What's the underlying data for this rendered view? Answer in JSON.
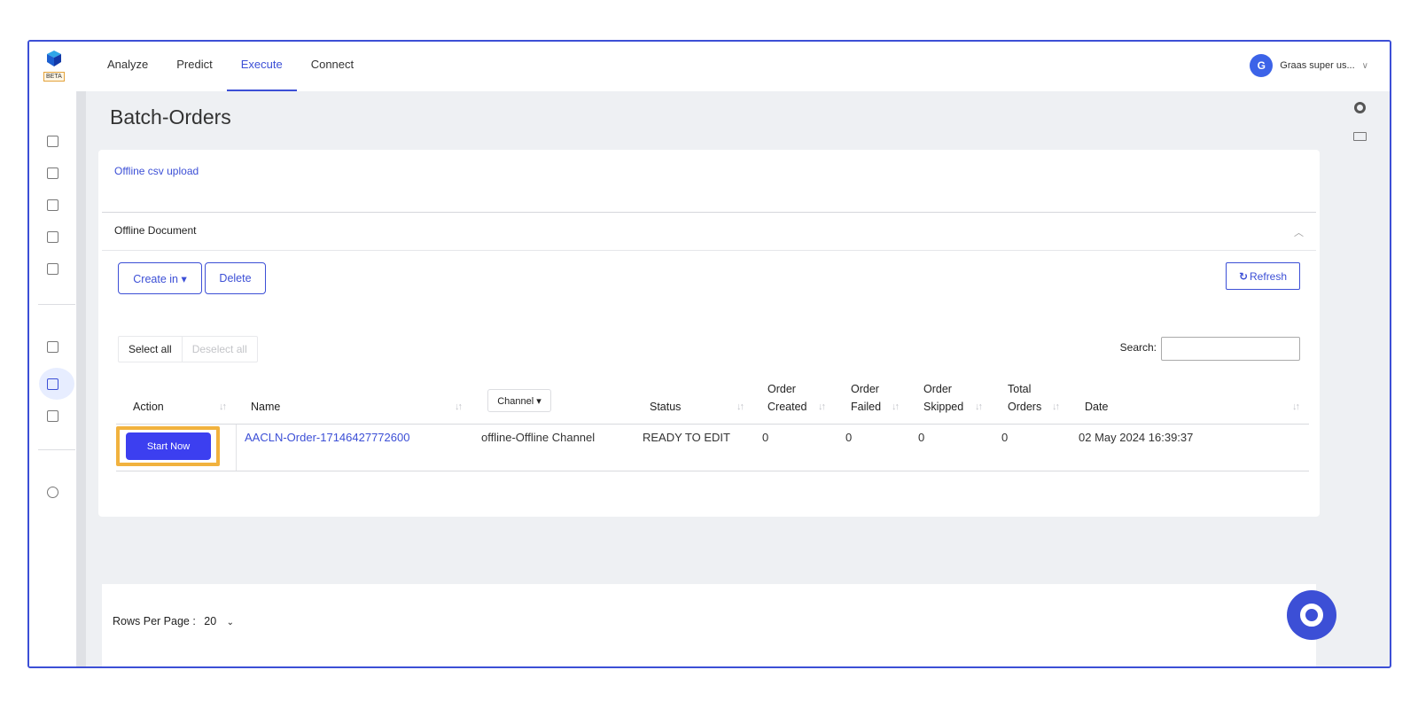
{
  "header": {
    "logo_badge": "BETA",
    "nav": [
      "Analyze",
      "Predict",
      "Execute",
      "Connect"
    ],
    "active_nav": "Execute",
    "user": {
      "initial": "G",
      "name": "Graas super us..."
    }
  },
  "page": {
    "title": "Batch-Orders"
  },
  "upload": {
    "link": "Offline csv upload"
  },
  "section": {
    "title": "Offline Document"
  },
  "toolbar": {
    "create": "Create in ▾",
    "delete": "Delete",
    "refresh": "Refresh"
  },
  "selection": {
    "select_all": "Select all",
    "deselect_all": "Deselect all"
  },
  "search": {
    "label": "Search:",
    "value": ""
  },
  "table": {
    "headers": {
      "action": "Action",
      "name": "Name",
      "channel": "Channel ▾",
      "status": "Status",
      "order_created": [
        "Order",
        "Created"
      ],
      "order_failed": [
        "Order",
        "Failed"
      ],
      "order_skipped": [
        "Order",
        "Skipped"
      ],
      "total_orders": [
        "Total",
        "Orders"
      ],
      "date": "Date"
    },
    "rows": [
      {
        "action": "Start Now",
        "name": "AACLN-Order-17146427772600",
        "channel": "offline-Offline Channel",
        "status": "READY TO EDIT",
        "order_created": "0",
        "order_failed": "0",
        "order_skipped": "0",
        "total_orders": "0",
        "date": "02 May 2024 16:39:37"
      }
    ]
  },
  "pagination": {
    "label": "Rows Per Page :",
    "value": "20"
  },
  "colors": {
    "accent": "#3c4fd6",
    "highlight": "#f1b23e",
    "button": "#3c3ff0"
  }
}
